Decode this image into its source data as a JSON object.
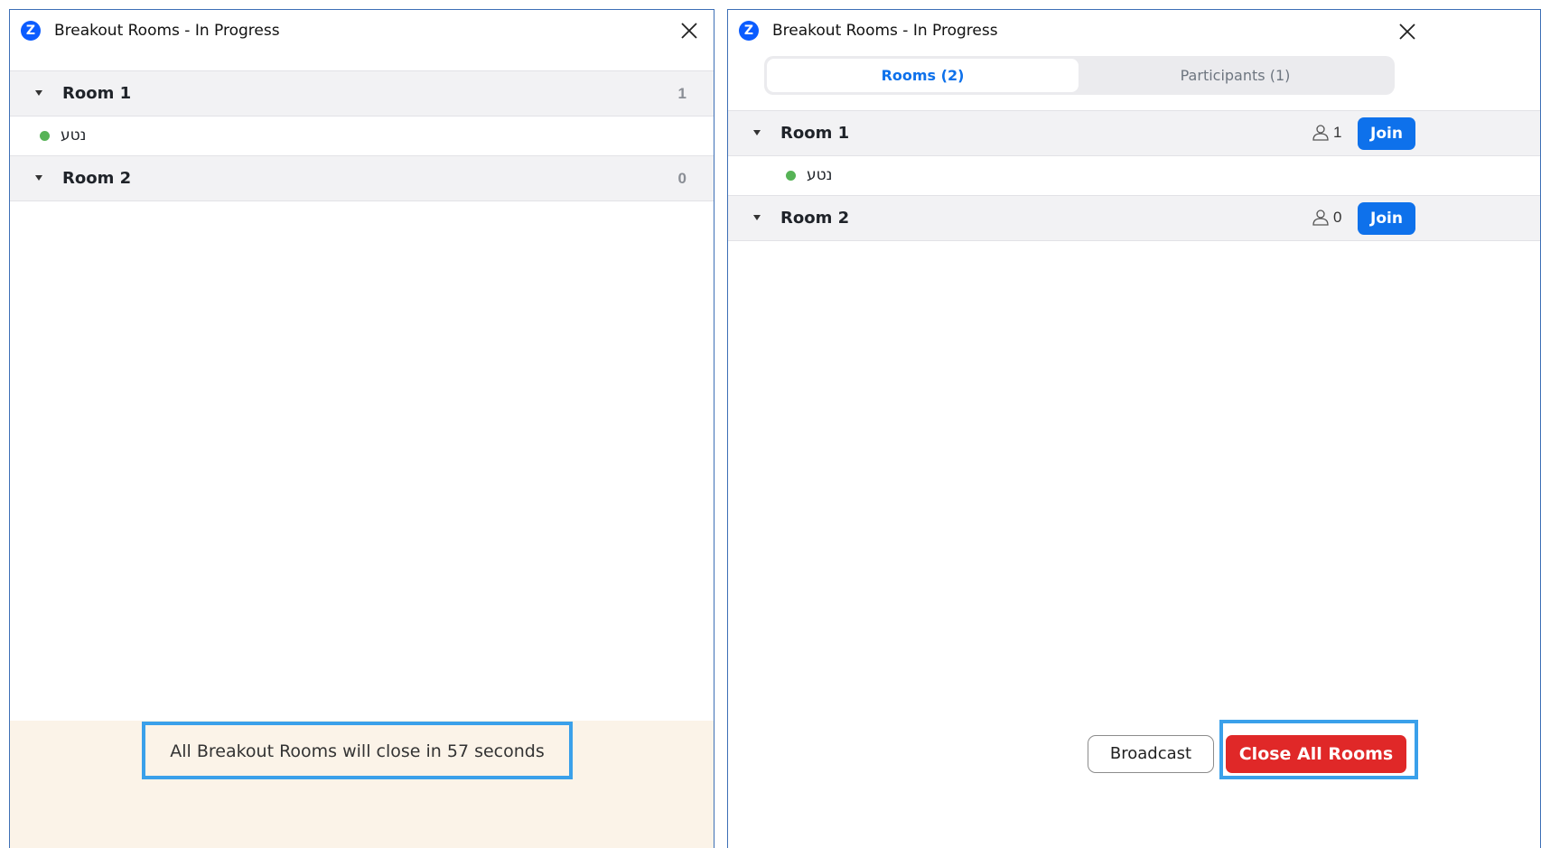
{
  "left_window": {
    "title": "Breakout Rooms - In Progress",
    "rooms": [
      {
        "name": "Room 1",
        "count": "1",
        "participants": [
          "נטע"
        ]
      },
      {
        "name": "Room 2",
        "count": "0",
        "participants": []
      }
    ],
    "countdown_text": "All Breakout Rooms will close in 57 seconds"
  },
  "right_window": {
    "title": "Breakout Rooms - In Progress",
    "tabs": [
      {
        "label": "Rooms (2)",
        "active": true
      },
      {
        "label": "Participants (1)",
        "active": false
      }
    ],
    "rooms": [
      {
        "name": "Room 1",
        "count": "1",
        "join_label": "Join",
        "participants": [
          "נטע"
        ]
      },
      {
        "name": "Room 2",
        "count": "0",
        "join_label": "Join",
        "participants": []
      }
    ],
    "broadcast_label": "Broadcast",
    "close_all_label": "Close All Rooms"
  },
  "icons": {
    "app": "zoom-logo-icon",
    "close": "close-icon",
    "expand": "caret-down-icon",
    "person": "person-icon",
    "status": "status-dot-icon"
  },
  "colors": {
    "accent_blue": "#0e71eb",
    "danger_red": "#e02828",
    "highlight_blue": "#3aa0ea",
    "banner_bg": "#fbf3e8",
    "online_green": "#56b356"
  }
}
